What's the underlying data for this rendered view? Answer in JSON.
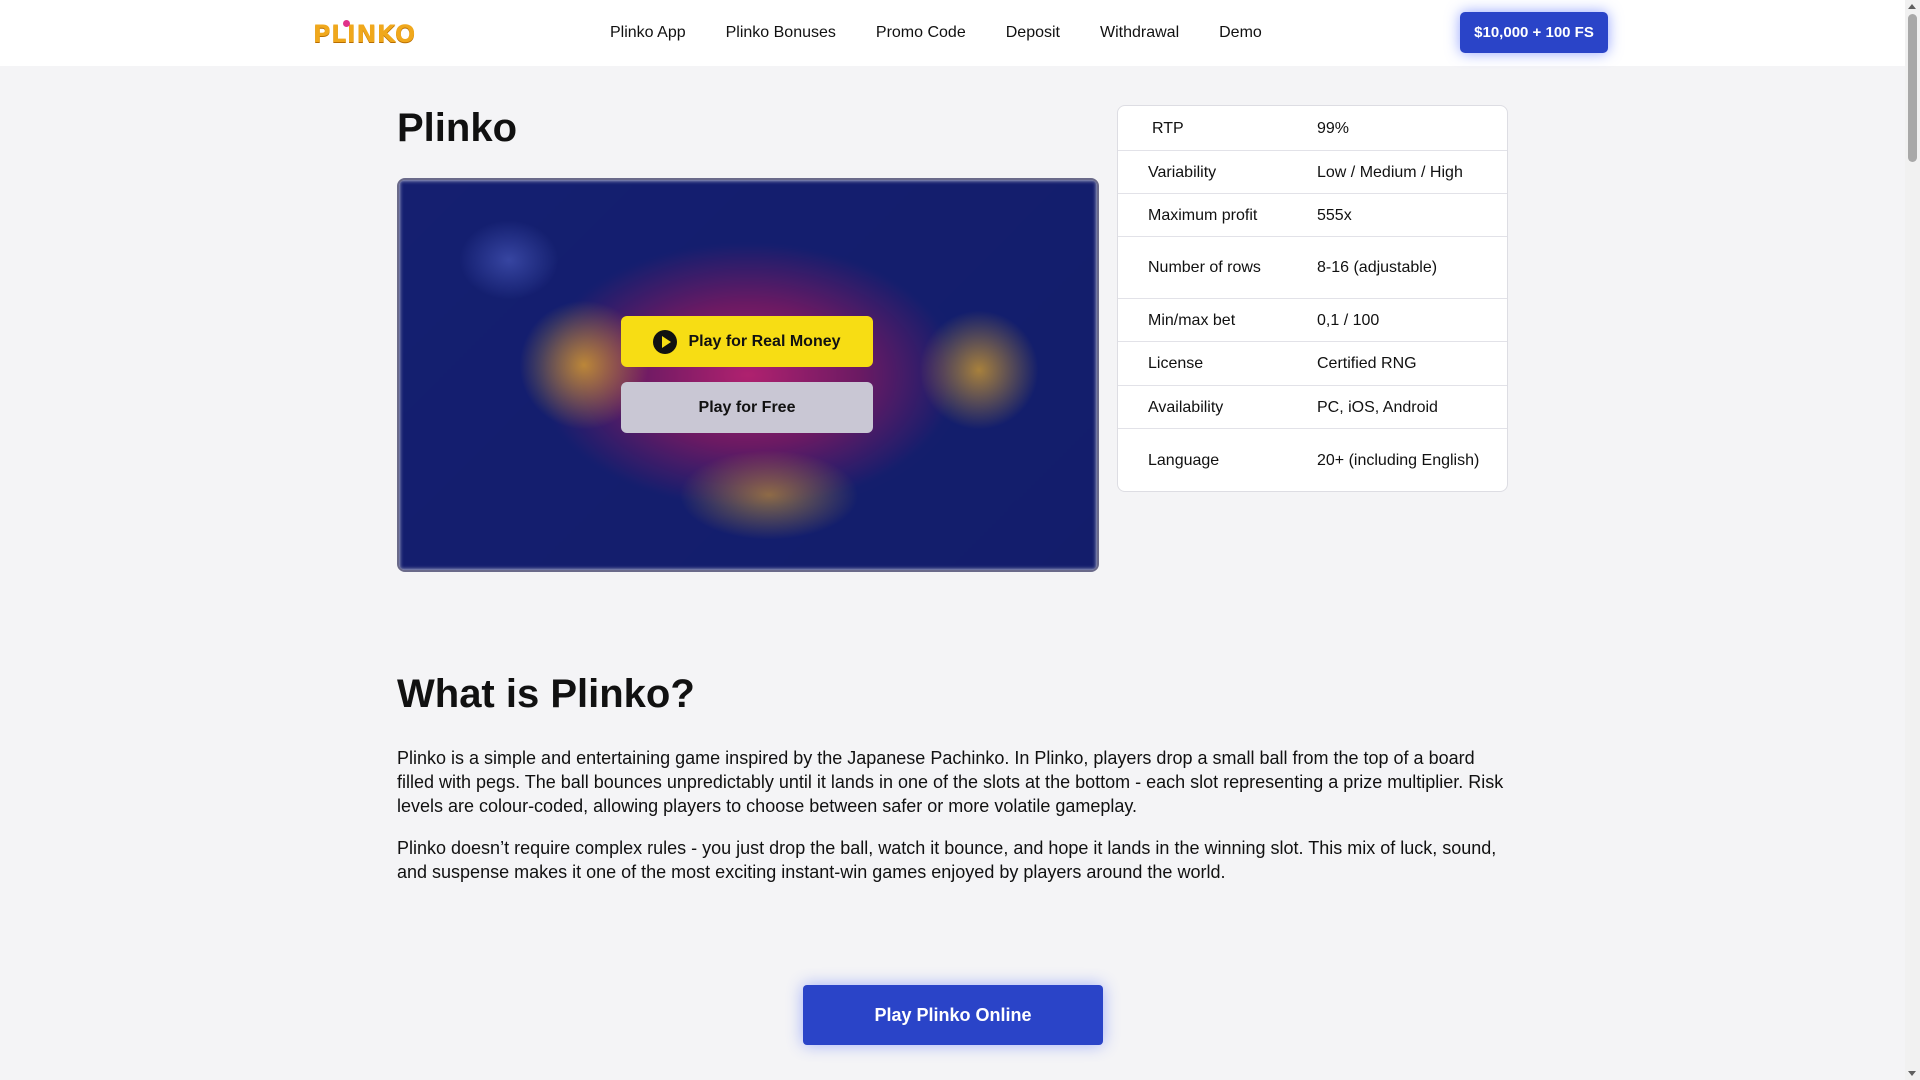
{
  "header": {
    "logo_text": "PLINKO",
    "nav": [
      "Plinko App",
      "Plinko Bonuses",
      "Promo Code",
      "Deposit",
      "Withdrawal",
      "Demo"
    ],
    "bonus_button": "$10,000 + 100 FS"
  },
  "main": {
    "title": "Plinko",
    "play_real_label": "Play for Real Money",
    "play_free_label": "Play for Free"
  },
  "info": [
    {
      "key": "RTP",
      "value": "99%"
    },
    {
      "key": "Variability",
      "value": "Low / Medium / High"
    },
    {
      "key": "Maximum profit",
      "value": "555x"
    },
    {
      "key": "Number of rows",
      "value": "8-16 (adjustable)"
    },
    {
      "key": "Min/max bet",
      "value": "0,1 / 100"
    },
    {
      "key": "License",
      "value": "Certified RNG"
    },
    {
      "key": "Availability",
      "value": "PC, iOS, Android"
    },
    {
      "key": "Language",
      "value": "20+ (including English)"
    }
  ],
  "about": {
    "title": "What is Plinko?",
    "paragraph1": "Plinko is a simple and entertaining game inspired by the Japanese Pachinko. In Plinko, players drop a small ball from the top of a board filled with pegs. The ball bounces unpredictably until it lands in one of the slots at the bottom - each slot representing a prize multiplier. Risk levels are colour-coded, allowing players to choose between safer or more volatile gameplay.",
    "paragraph2": "Plinko doesn’t require complex rules - you just drop the ball, watch it bounce, and hope it lands in the winning slot. This mix of luck, sound, and suspense makes it one of the most exciting instant-win games enjoyed by players around the world.",
    "cta_label": "Play Plinko Online"
  },
  "colors": {
    "accent_blue": "#2a44c8",
    "play_yellow": "#f7dd14",
    "free_gray": "#c9c7d4",
    "logo_orange": "#f0a81c"
  },
  "icons": {
    "play": "play-circle-icon",
    "logo_dot": "logo-dot-icon"
  }
}
